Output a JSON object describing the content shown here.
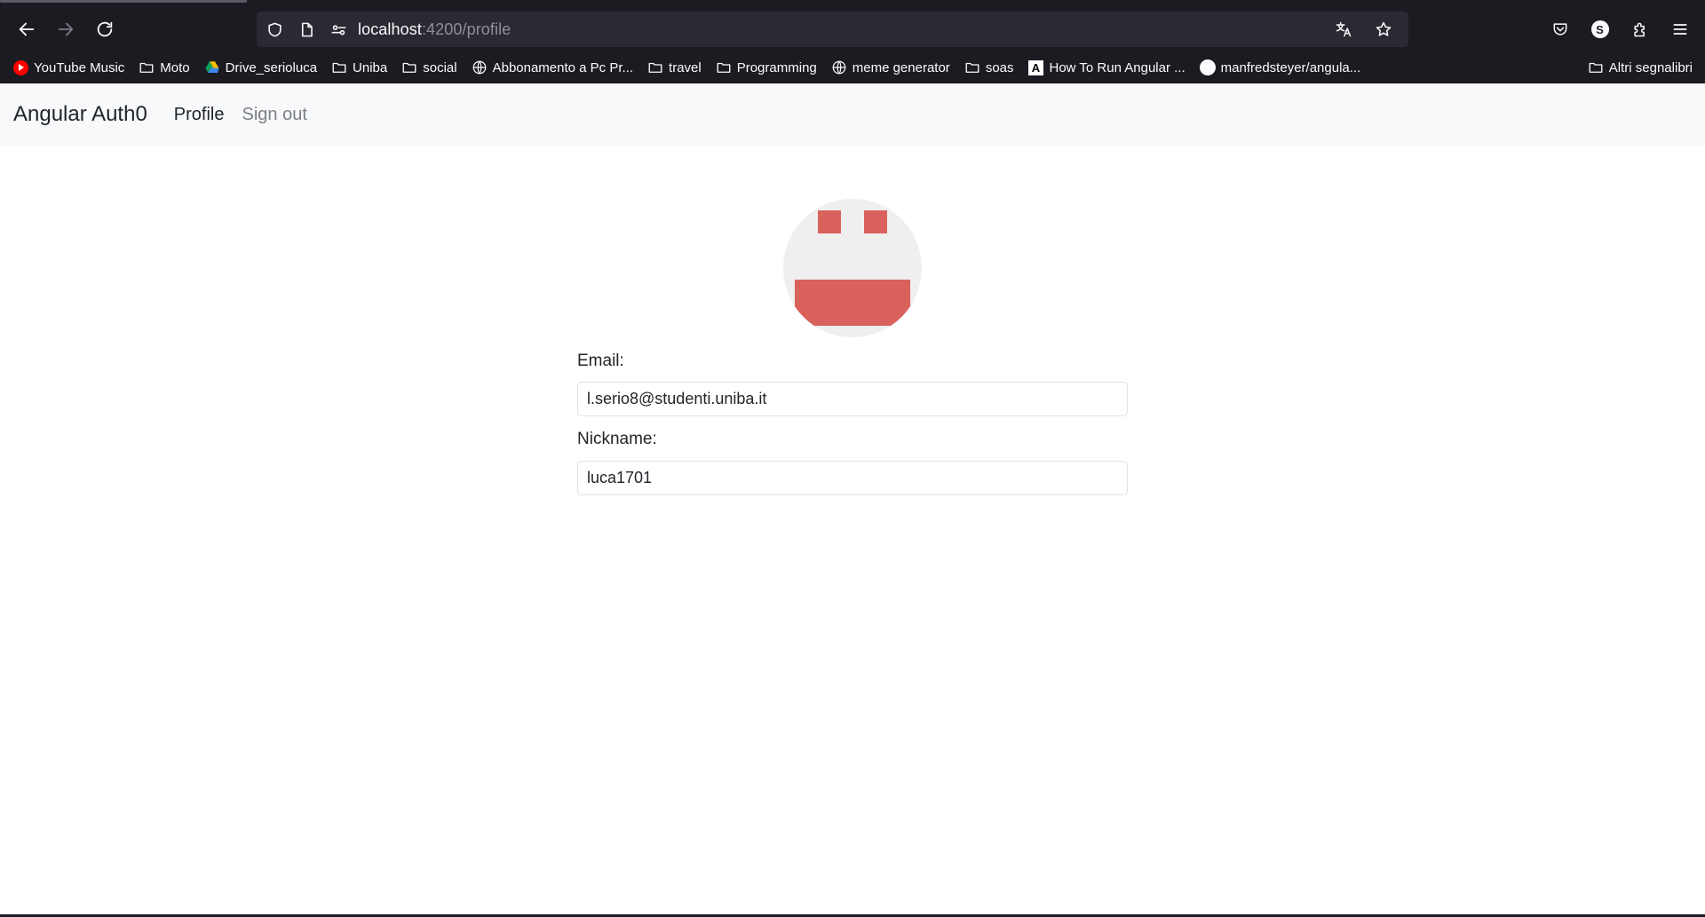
{
  "browser": {
    "url_host": "localhost",
    "url_path": ":4200/profile",
    "nav_icons": [
      "back-arrow-icon",
      "forward-arrow-icon",
      "reload-icon"
    ],
    "url_icons": [
      "shield-icon",
      "page-icon",
      "permissions-icon",
      "translate-icon",
      "star-icon"
    ],
    "toolbar_icons": [
      "pocket-icon",
      "account-icon",
      "extensions-icon",
      "menu-icon"
    ],
    "account_initial": "S",
    "bookmarks": [
      {
        "label": "YouTube Music",
        "icon": "youtube-music-icon"
      },
      {
        "label": "Moto",
        "icon": "folder-icon"
      },
      {
        "label": "Drive_serioluca",
        "icon": "google-drive-icon"
      },
      {
        "label": "Uniba",
        "icon": "folder-icon"
      },
      {
        "label": "social",
        "icon": "folder-icon"
      },
      {
        "label": "Abbonamento a Pc Pr...",
        "icon": "globe-icon"
      },
      {
        "label": "travel",
        "icon": "folder-icon"
      },
      {
        "label": "Programming",
        "icon": "folder-icon"
      },
      {
        "label": "meme generator",
        "icon": "globe-icon"
      },
      {
        "label": "soas",
        "icon": "folder-icon"
      },
      {
        "label": "How To Run Angular ...",
        "icon": "angular-icon"
      },
      {
        "label": "manfredsteyer/angula...",
        "icon": "github-icon"
      }
    ],
    "other_bookmarks": "Altri segnalibri"
  },
  "app": {
    "brand": "Angular Auth0",
    "nav": {
      "profile": "Profile",
      "signout": "Sign out"
    }
  },
  "profile": {
    "avatar_icon": "identicon-avatar",
    "avatar_colors": {
      "background": "#efefef",
      "foreground": "#d9625c"
    },
    "email_label": "Email:",
    "email_value": "l.serio8@studenti.uniba.it",
    "nickname_label": "Nickname:",
    "nickname_value": "luca1701"
  }
}
